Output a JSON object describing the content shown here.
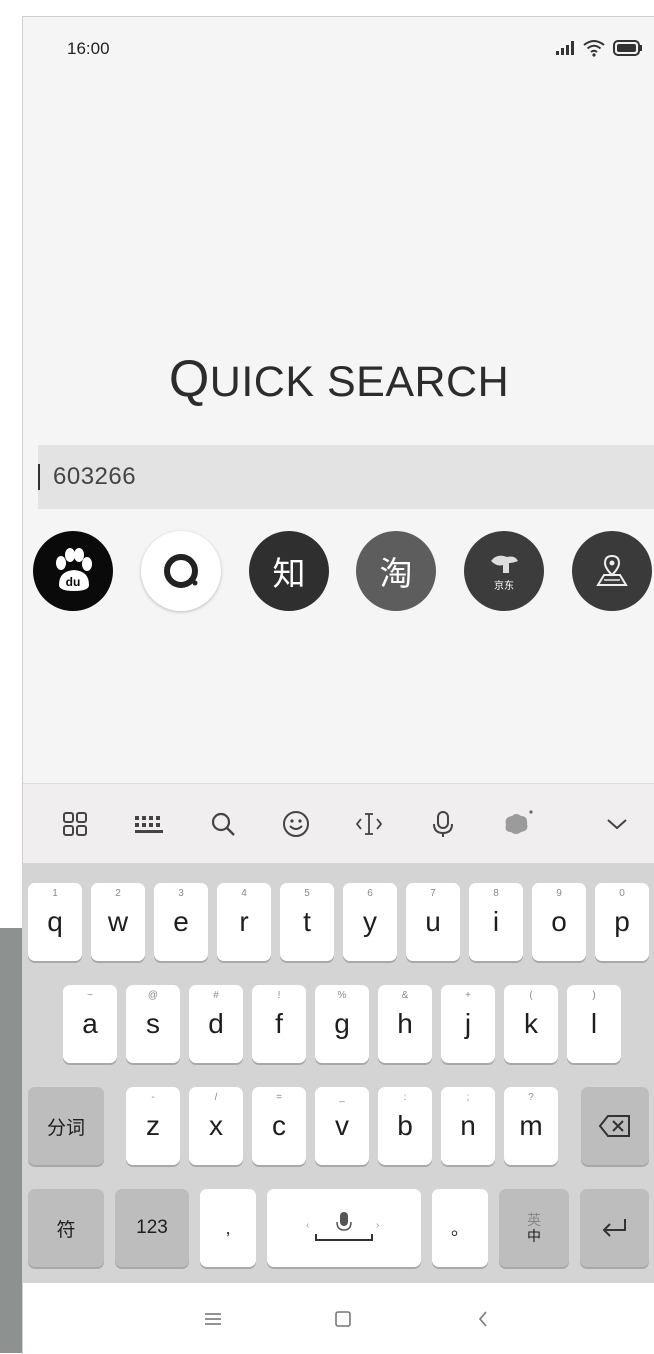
{
  "status_bar": {
    "time": "16:00"
  },
  "app": {
    "title_first": "Q",
    "title_rest": "UICK SEARCH"
  },
  "search": {
    "value": "603266"
  },
  "engines": [
    {
      "name": "baidu",
      "label": "du"
    },
    {
      "name": "ring",
      "label": ""
    },
    {
      "name": "zhihu",
      "label": "知"
    },
    {
      "name": "taobao",
      "label": "淘"
    },
    {
      "name": "jingdong",
      "label": "京东"
    },
    {
      "name": "map",
      "label": ""
    }
  ],
  "keyboard": {
    "row1": [
      {
        "key": "q",
        "hint": "1"
      },
      {
        "key": "w",
        "hint": "2"
      },
      {
        "key": "e",
        "hint": "3"
      },
      {
        "key": "r",
        "hint": "4"
      },
      {
        "key": "t",
        "hint": "5"
      },
      {
        "key": "y",
        "hint": "6"
      },
      {
        "key": "u",
        "hint": "7"
      },
      {
        "key": "i",
        "hint": "8"
      },
      {
        "key": "o",
        "hint": "9"
      },
      {
        "key": "p",
        "hint": "0"
      }
    ],
    "row2": [
      {
        "key": "a",
        "hint": "~"
      },
      {
        "key": "s",
        "hint": "@"
      },
      {
        "key": "d",
        "hint": "#"
      },
      {
        "key": "f",
        "hint": "!"
      },
      {
        "key": "g",
        "hint": "%"
      },
      {
        "key": "h",
        "hint": "&"
      },
      {
        "key": "j",
        "hint": "+"
      },
      {
        "key": "k",
        "hint": "("
      },
      {
        "key": "l",
        "hint": ")"
      }
    ],
    "row3": [
      {
        "key": "z",
        "hint": "-"
      },
      {
        "key": "x",
        "hint": "/"
      },
      {
        "key": "c",
        "hint": "="
      },
      {
        "key": "v",
        "hint": "_"
      },
      {
        "key": "b",
        "hint": ":"
      },
      {
        "key": "n",
        "hint": ";"
      },
      {
        "key": "m",
        "hint": "?"
      }
    ],
    "segment_label": "分词",
    "symbols_label": "符",
    "numbers_label": "123",
    "comma": ",",
    "period": "。",
    "lang_top": "英",
    "lang_bottom": "中"
  }
}
